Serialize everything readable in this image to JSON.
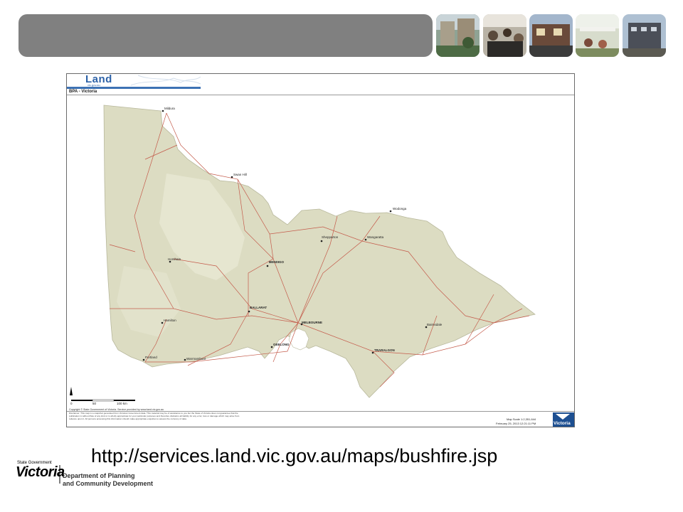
{
  "colors": {
    "banner": "#808080",
    "land": "#dcdcc2",
    "roads": "#c45b4b",
    "brand_blue": "#2d62a8"
  },
  "header": {
    "thumbnails": [
      "photo-modern-building-courtyard",
      "photo-cafe-diners",
      "photo-townhouses",
      "photo-outdoor-street-cafe",
      "photo-apartment-block"
    ]
  },
  "map": {
    "logo_word": "Land",
    "logo_sub": "vic.gov.au",
    "title": "BPA - Victoria",
    "places": [
      {
        "name": "Mildura",
        "bold": false
      },
      {
        "name": "Swan Hill",
        "bold": false
      },
      {
        "name": "Wodonga",
        "bold": false
      },
      {
        "name": "Wangaratta",
        "bold": false
      },
      {
        "name": "Shepparton",
        "bold": false
      },
      {
        "name": "Horsham",
        "bold": false
      },
      {
        "name": "BENDIGO",
        "bold": true
      },
      {
        "name": "BALLARAT",
        "bold": true
      },
      {
        "name": "MELBOURNE",
        "bold": true
      },
      {
        "name": "Hamilton",
        "bold": false
      },
      {
        "name": "GEELONG",
        "bold": true
      },
      {
        "name": "Portland",
        "bold": false
      },
      {
        "name": "Warrnambool",
        "bold": false
      },
      {
        "name": "Bairnsdale",
        "bold": false
      },
      {
        "name": "TRARALGON",
        "bold": true
      }
    ],
    "scale_ticks": [
      "0",
      "50",
      "100 km"
    ],
    "copyright": "Copyright © State Government of Victoria. Service provided by www.land.vic.gov.au",
    "disclaimer": "Disclaimer: This map is a snapshot generated from Victorian Government data. This material may be of assistance to you but the State of Victoria does not guarantee that the publication is without flaw of any kind or is wholly appropriate for your particular purposes and therefore disclaims all liability for any error, loss or damage which may arise from reliance upon it. All persons accessing this information should make appropriate enquiries to assess the currency of data.",
    "scale": "Map Scale 1:2,351,644",
    "date": "February 25, 2013 12:21:11 PM",
    "badge": "Victoria"
  },
  "url": "http://services.land.vic.gov.au/maps/bushfire.jsp",
  "footer": {
    "state_government": "State Government",
    "victoria": "Victoria",
    "dept_line1": "Department of Planning",
    "dept_line2": "and Community Development"
  }
}
